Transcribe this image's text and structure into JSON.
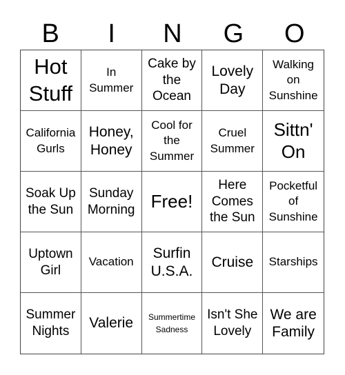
{
  "header": {
    "letters": [
      "B",
      "I",
      "N",
      "G",
      "O"
    ]
  },
  "cells": [
    "Hot Stuff",
    "In Summer",
    "Cake by the Ocean",
    "Lovely Day",
    "Walking on Sunshine",
    "California Gurls",
    "Honey, Honey",
    "Cool for the Summer",
    "Cruel Summer",
    "Sittn' On",
    "Soak Up the Sun",
    "Sunday Morning",
    "Free!",
    "Here Comes the Sun",
    "Pocketful of Sunshine",
    "Uptown Girl",
    "Vacation",
    "Surfin U.S.A.",
    "Cruise",
    "Starships",
    "Summer Nights",
    "Valerie",
    "Summertime Sadness",
    "Isn't She Lovely",
    "We are Family"
  ]
}
